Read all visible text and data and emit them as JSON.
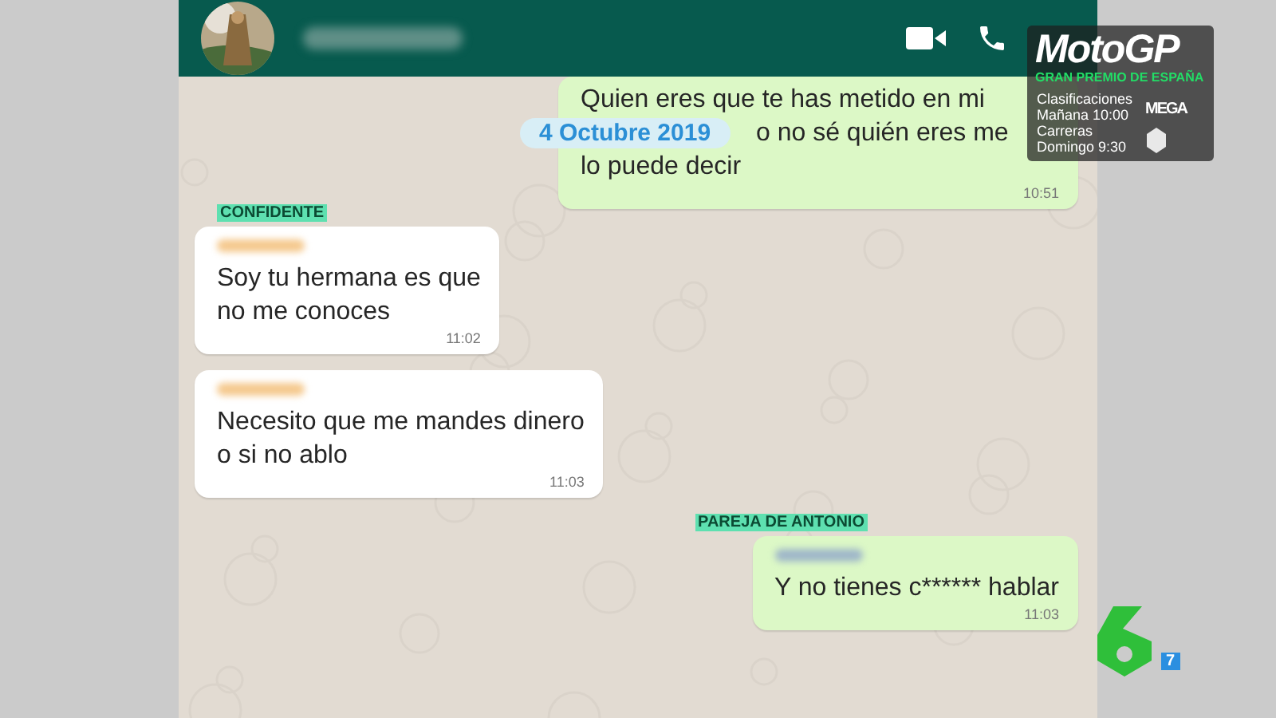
{
  "chat": {
    "date_chip": "4 Octubre 2019",
    "items": [
      {
        "kind": "message",
        "outgoing": true,
        "sender_blurred": false,
        "lines": [
          "Quien eres que te has metido en mi",
          "o no sé quién eres me",
          "lo puede decir"
        ],
        "time": "10:51"
      },
      {
        "kind": "caption",
        "text": "CONFIDENTE"
      },
      {
        "kind": "message",
        "outgoing": false,
        "sender_blurred": true,
        "lines": [
          "Soy tu hermana es que",
          "no me conoces"
        ],
        "time": "11:02"
      },
      {
        "kind": "message",
        "outgoing": false,
        "sender_blurred": true,
        "lines": [
          "Necesito que me mandes dinero",
          "o si no ablo"
        ],
        "time": "11:03"
      },
      {
        "kind": "caption",
        "text": "PAREJA DE ANTONIO"
      },
      {
        "kind": "message",
        "outgoing": true,
        "sender_blurred": true,
        "lines": [
          "Y no tienes c****** hablar"
        ],
        "time": "11:03"
      }
    ]
  },
  "broadcast": {
    "title": "MotoGP",
    "subtitle": "GRAN PREMIO DE ESPAÑA",
    "schedule": [
      "Clasificaciones",
      "Mañana 10:00",
      "Carreras",
      "Domingo 9:30"
    ],
    "channel": "MEGA",
    "badge": "7"
  }
}
